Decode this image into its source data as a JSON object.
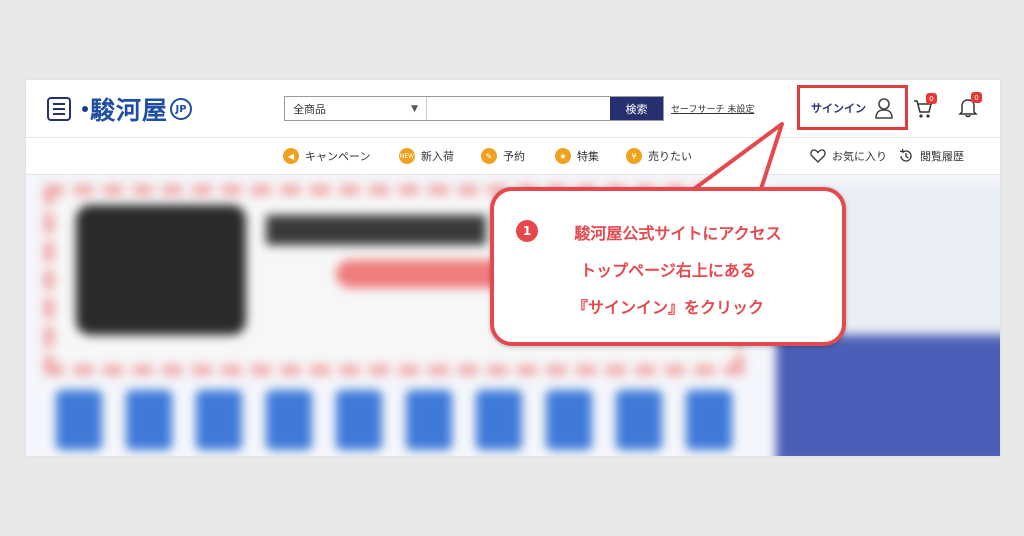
{
  "header": {
    "logo_text": "駿河屋",
    "logo_badge": "JP",
    "search": {
      "category": "全商品",
      "placeholder": "",
      "button": "検索"
    },
    "safe_search": "セーフサーチ 未設定",
    "signin_label": "サインイン",
    "cart_count": "0",
    "notification_count": "0"
  },
  "nav": {
    "items": [
      {
        "label": "キャンペーン",
        "icon": "megaphone-icon"
      },
      {
        "label": "新入荷",
        "icon": "new-icon",
        "icon_text": "NEW"
      },
      {
        "label": "予約",
        "icon": "reserve-icon"
      },
      {
        "label": "特集",
        "icon": "shield-icon"
      },
      {
        "label": "売りたい",
        "icon": "sell-icon"
      }
    ],
    "favorites": "お気に入り",
    "history": "閲覧履歴"
  },
  "callout": {
    "step": "1",
    "lines": [
      "駿河屋公式サイトにアクセス",
      "トップページ右上にある",
      "『サインイン』をクリック"
    ]
  },
  "colors": {
    "brand_navy": "#27306e",
    "accent_red": "#e5484d",
    "nav_orange": "#f0a21f"
  }
}
